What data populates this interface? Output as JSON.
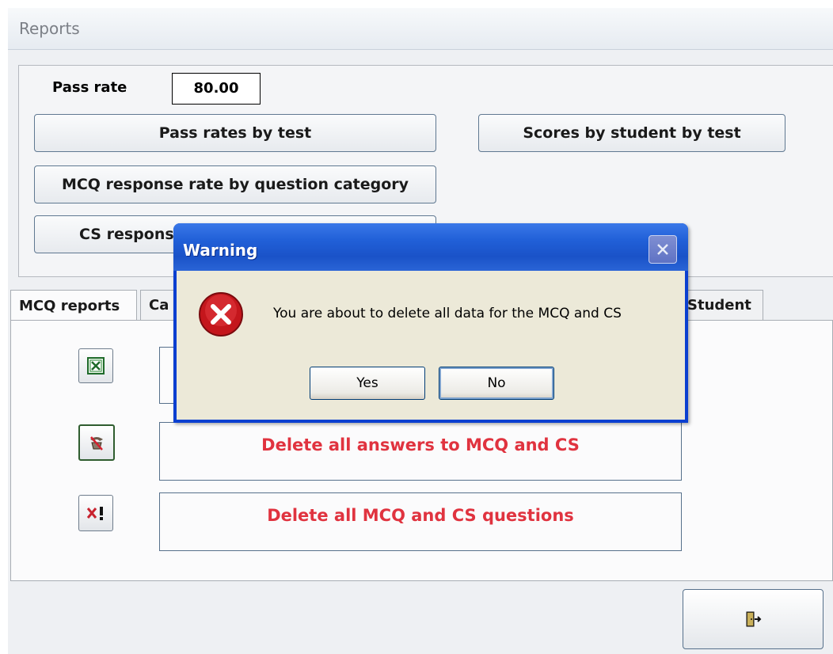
{
  "window": {
    "title": "Reports"
  },
  "pass_rate": {
    "label": "Pass rate",
    "value": "80.00"
  },
  "reports": {
    "pass_rates_by_test": "Pass rates by test",
    "scores_by_student": "Scores by student by test",
    "mcq_response_rate": "MCQ response rate by question category",
    "cs_response": "CS respons"
  },
  "tabs": [
    {
      "label": "MCQ reports"
    },
    {
      "label": "Ca"
    },
    {
      "label": "Student"
    }
  ],
  "actions": {
    "delete_answers": "Delete all answers to MCQ and CS",
    "delete_questions": "Delete all MCQ and CS questions"
  },
  "icons": {
    "excel": "excel-icon",
    "delete_answers": "delete-answers-icon",
    "delete_questions": "delete-questions-icon",
    "exit": "exit-door-icon",
    "error": "error-icon",
    "close": "close-icon"
  },
  "dialog": {
    "title": "Warning",
    "message": "You are about to delete all data for the MCQ and CS",
    "yes_label": "Yes",
    "no_label": "No"
  },
  "colors": {
    "danger_text": "#e0333f",
    "dialog_title_blue": "#2160d8",
    "dialog_body": "#ece9d8"
  }
}
